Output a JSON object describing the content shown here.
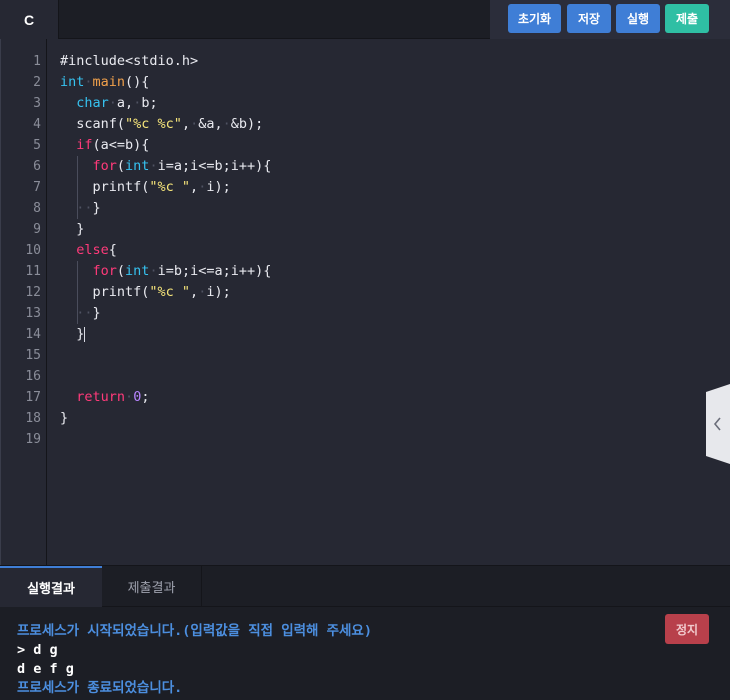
{
  "top": {
    "language": "C",
    "buttons": {
      "reset": "초기화",
      "save": "저장",
      "run": "실행",
      "submit": "제출"
    }
  },
  "editor": {
    "line_numbers": [
      "1",
      "2",
      "3",
      "4",
      "5",
      "6",
      "7",
      "8",
      "9",
      "10",
      "11",
      "12",
      "13",
      "14",
      "15",
      "16",
      "17",
      "18",
      "19"
    ],
    "code_lines": [
      "#include<stdio.h>",
      "int main(){",
      "  char a, b;",
      "  scanf(\"%c %c\", &a, &b);",
      "  if(a<=b){",
      "    for(int i=a;i<=b;i++){",
      "    printf(\"%c \", i);",
      "    }",
      "  }",
      "  else{",
      "    for(int i=b;i<=a;i++){",
      "    printf(\"%c \", i);",
      "    }",
      "  }",
      "",
      "",
      "  return 0;",
      "}",
      ""
    ],
    "side_handle_icon": "chevron-left-icon"
  },
  "bottom": {
    "tabs": {
      "run_result": "실행결과",
      "submit_result": "제출결과"
    },
    "stop": "정지",
    "console": {
      "start": "프로세스가 시작되었습니다.(입력값을 직접 입력해 주세요)",
      "input": "> d g",
      "output": "d e f g",
      "end": "프로세스가 종료되었습니다."
    }
  }
}
